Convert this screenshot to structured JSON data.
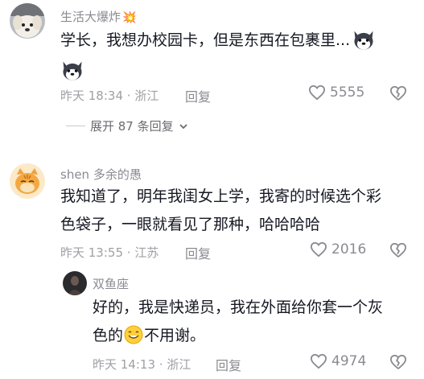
{
  "comments": [
    {
      "username": "生活大爆炸",
      "username_emoji": "💥",
      "text_lines": [
        "学长，我想办校园卡，但是东西在包裹里..."
      ],
      "time": "昨天 18:34",
      "location": "浙江",
      "reply_label": "回复",
      "likes": "5555",
      "expand_label": "展开 87 条回复"
    },
    {
      "username": "shen 多余的愚",
      "text_lines": [
        "我知道了，明年我闺女上学，我寄的时候选个彩",
        "色袋子，一眼就看见了那种，哈哈哈哈"
      ],
      "time": "昨天 13:55",
      "location": "江苏",
      "reply_label": "回复",
      "likes": "2016"
    },
    {
      "username": "双鱼座",
      "text_lines": [
        "好的，我是快递员，我在外面给你套一个灰",
        "色的",
        "不用谢。"
      ],
      "time": "昨天 14:13",
      "location": "浙江",
      "reply_label": "回复",
      "likes": "4974"
    }
  ],
  "separator": " · ",
  "colors": {
    "text_primary": "#161823",
    "text_secondary": "#8a8b91",
    "text_meta": "#9fa0a6"
  },
  "icons": [
    "husky-emoji-icon",
    "smile-emoji-icon",
    "heart-icon",
    "broken-heart-icon",
    "chevron-down-icon",
    "explosion-emoji-icon"
  ]
}
